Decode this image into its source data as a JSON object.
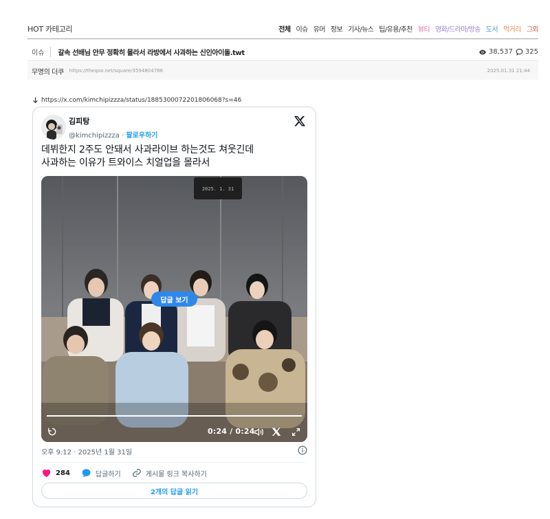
{
  "hot_bar": {
    "title": "HOT 카테고리",
    "categories": [
      {
        "label": "전체",
        "color": "#222222",
        "active": true
      },
      {
        "label": "이슈",
        "color": "#333333"
      },
      {
        "label": "유머",
        "color": "#333333"
      },
      {
        "label": "정보",
        "color": "#333333"
      },
      {
        "label": "기사/뉴스",
        "color": "#333333"
      },
      {
        "label": "팁/유용/추천",
        "color": "#333333"
      },
      {
        "label": "뷰티",
        "color": "#e36fa0"
      },
      {
        "label": "영화/드라마/방송",
        "color": "#9b7fd1"
      },
      {
        "label": "도서",
        "color": "#4a9ed8"
      },
      {
        "label": "먹거리",
        "color": "#e98c4c"
      },
      {
        "label": "그외",
        "color": "#d35b3a"
      }
    ]
  },
  "post": {
    "category": "이슈",
    "title": "갈속 선배님 안무 정확히 몰라서 라방에서 사과하는 신인아이돌.twt",
    "views": "38,537",
    "comments": "325",
    "author": "무명의 더쿠",
    "url": "https://theqoo.net/square/3594804786",
    "date": "2025.01.31 21:44"
  },
  "embed": {
    "link": "https://x.com/kimchipizzza/status/1885300072201806068?s=46"
  },
  "tweet": {
    "display_name": "김피탕",
    "handle": "@kimchipizzza",
    "separator": " · ",
    "follow_label": "팔로우하기",
    "text_lines": [
      "데뷔한지 2주도 안돼서 사과라이브 하는것도 쳐웃긴데",
      "사과하는 이유가 트와이스 치얼업을 몰라서"
    ],
    "media": {
      "reply_pill": "답글 보기",
      "time": "0:24 / 0:24",
      "progress": 1.0,
      "clock_text": "2025. 1. 31"
    },
    "timestamp": "오후 9:12 · 2025년 1월 31일",
    "likes": "284",
    "reply_label": "답글하기",
    "copy_label": "게시물 링크 복사하기",
    "read_replies": "2개의 답글 읽기"
  },
  "colors": {
    "x_blue": "#1d9bf0",
    "heart": "#f91880",
    "pill": "#2f88e8",
    "border": "#cfd9de"
  }
}
